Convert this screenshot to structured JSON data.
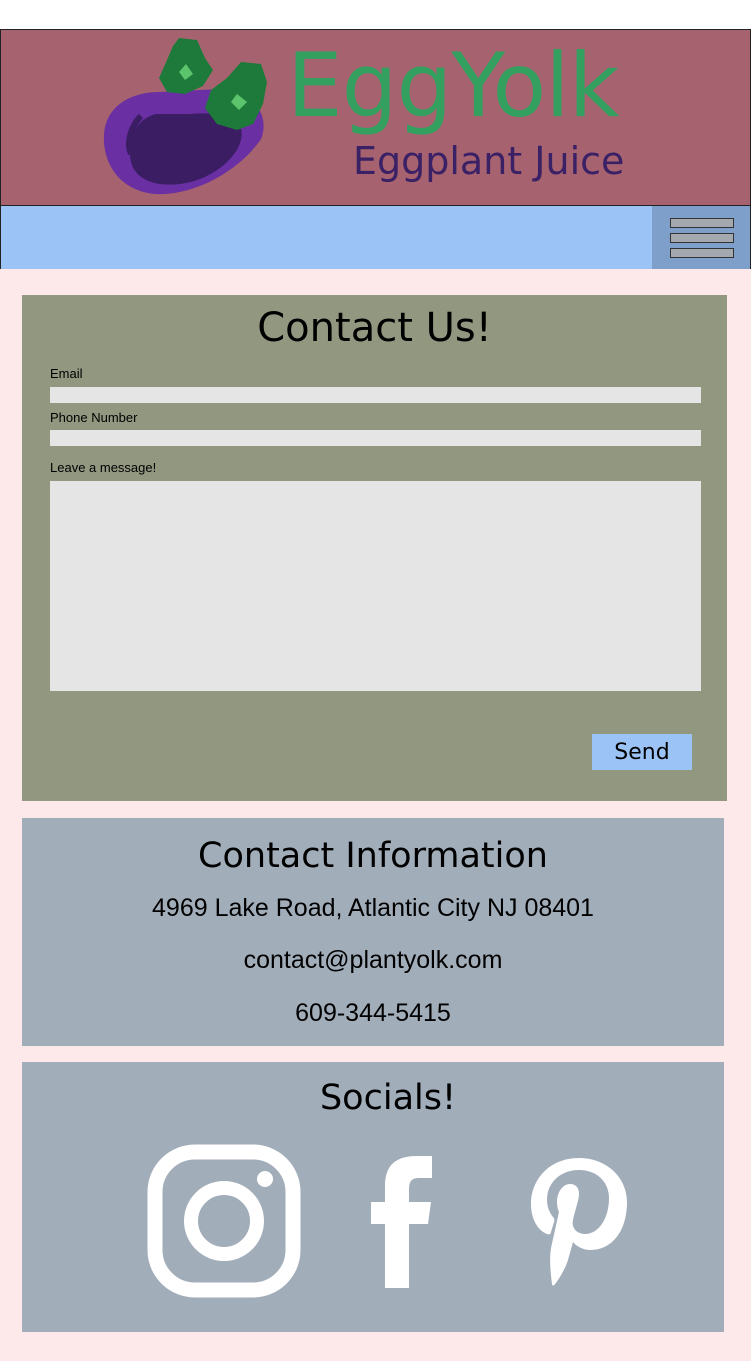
{
  "brand": {
    "name": "EggYolk",
    "tagline": "Eggplant Juice"
  },
  "navbar": {
    "menu_icon": "hamburger-menu-icon"
  },
  "contact_form": {
    "title": "Contact Us!",
    "email_label": "Email",
    "phone_label": "Phone Number",
    "message_label": "Leave a message!",
    "email_value": "",
    "phone_value": "",
    "message_value": "",
    "send_label": "Send"
  },
  "contact_info": {
    "title": "Contact Information",
    "address": "4969 Lake Road, Atlantic City NJ 08401",
    "email": "contact@plantyolk.com",
    "phone": "609-344-5415"
  },
  "socials": {
    "title": "Socials!",
    "icons": [
      "instagram-icon",
      "facebook-icon",
      "pinterest-icon"
    ]
  },
  "colors": {
    "header_bg": "#a6636f",
    "brand_green": "#33a060",
    "brand_purple": "#3a2065",
    "nav_blue": "#9cc3f6",
    "page_bg": "#fde9ea",
    "form_panel": "#929780",
    "info_panel": "#a2adba"
  }
}
